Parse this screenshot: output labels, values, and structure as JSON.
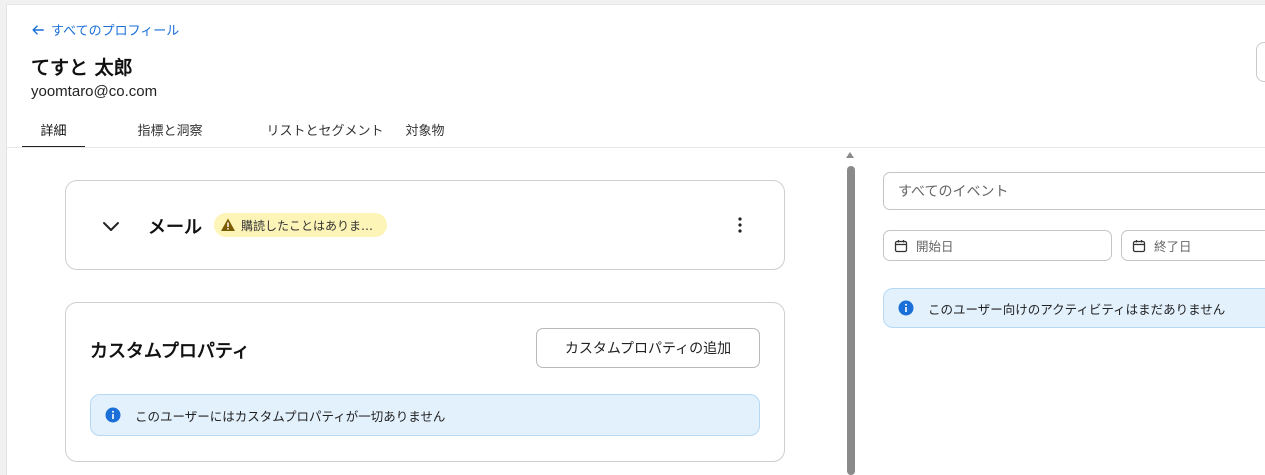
{
  "header": {
    "back_label": "すべてのプロフィール",
    "profile_name": "てすと 太郎",
    "profile_email": "yoomtaro@co.com"
  },
  "tabs": [
    {
      "label": "詳細",
      "active": true
    },
    {
      "label": "指標と洞察",
      "active": false
    },
    {
      "label": "リストとセグメント",
      "active": false
    },
    {
      "label": "対象物",
      "active": false
    }
  ],
  "email_card": {
    "title": "メール",
    "badge_text": "購読したことはありま…",
    "badge_icon": "warning-icon",
    "menu_icon": "kebab-menu-icon",
    "toggle_icon": "chevron-down-icon"
  },
  "custom_properties": {
    "title": "カスタムプロパティ",
    "add_button_label": "カスタムプロパティの追加",
    "empty_message": "このユーザーにはカスタムプロパティが一切ありません"
  },
  "activity": {
    "event_filter_placeholder": "すべてのイベント",
    "start_date_placeholder": "開始日",
    "end_date_placeholder": "終了日",
    "empty_message": "このユーザー向けのアクティビティはまだありません"
  },
  "colors": {
    "link": "#1a6fd8",
    "warning_badge_bg": "#fdf4b7",
    "warning_icon": "#7a5b00",
    "info_bg": "#e3f1fd",
    "info_icon": "#1a6fd8",
    "active_tab_underline": "#222222"
  }
}
